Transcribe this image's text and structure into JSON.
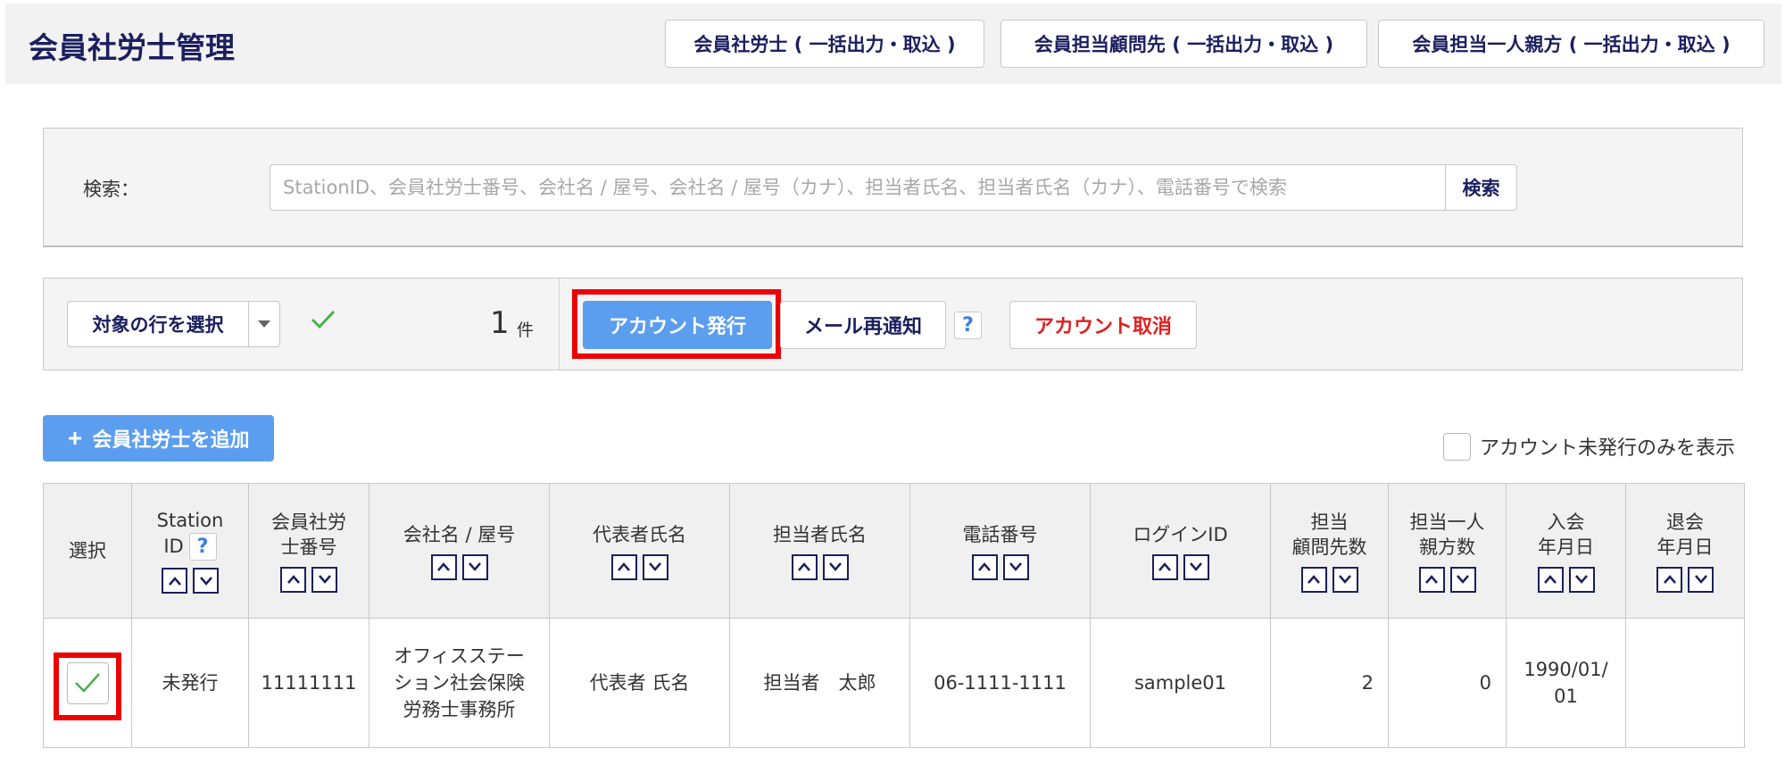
{
  "header": {
    "title": "会員社労士管理",
    "buttons": [
      "会員社労士 ( 一括出力・取込 )",
      "会員担当顧問先 ( 一括出力・取込 )",
      "会員担当一人親方 ( 一括出力・取込 )"
    ]
  },
  "search": {
    "label": "検索：",
    "placeholder": "StationID、会員社労士番号、会社名 / 屋号、会社名 / 屋号（カナ）、担当者氏名、担当者氏名（カナ）、電話番号で検索",
    "button": "検索"
  },
  "actions": {
    "select_rows": "対象の行を選択",
    "count": "1",
    "count_unit": "件",
    "issue_account": "アカウント発行",
    "resend_mail": "メール再通知",
    "help": "?",
    "cancel_account": "アカウント取消"
  },
  "add_button": "会員社労士を追加",
  "filter_label": "アカウント未発行のみを表示",
  "table": {
    "headers": {
      "select": "選択",
      "station_id": [
        "Station",
        "ID"
      ],
      "member_no": [
        "会員社労",
        "士番号"
      ],
      "company": "会社名 / 屋号",
      "rep_name": "代表者氏名",
      "contact_name": "担当者氏名",
      "phone": "電話番号",
      "login_id": "ログインID",
      "advisors": [
        "担当",
        "顧問先数"
      ],
      "solo": [
        "担当一人",
        "親方数"
      ],
      "join_date": [
        "入会",
        "年月日"
      ],
      "leave_date": [
        "退会",
        "年月日"
      ]
    },
    "rows": [
      {
        "checked": true,
        "station_id": "未発行",
        "member_no": "11111111",
        "company": [
          "オフィスステー",
          "ション社会保険",
          "労務士事務所"
        ],
        "rep_name": "代表者 氏名",
        "contact_name": "担当者　太郎",
        "phone": "06-1111-1111",
        "login_id": "sample01",
        "advisors": "2",
        "solo": "0",
        "join_date": [
          "1990/01/",
          "01"
        ],
        "leave_date": ""
      }
    ]
  },
  "colors": {
    "primary": "#5b9ef0",
    "navy": "#1b1f5e",
    "danger": "#e02020",
    "highlight": "#ee0000",
    "check": "#4caf50"
  }
}
